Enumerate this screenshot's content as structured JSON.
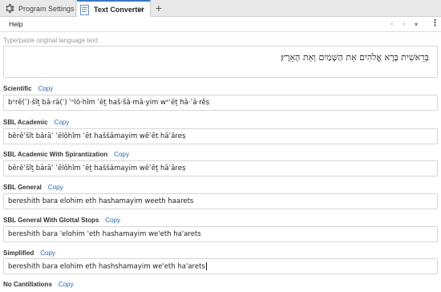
{
  "tabs": [
    {
      "label": "Program Settings",
      "icon": "gear-icon",
      "active": false
    },
    {
      "label": "Text Converter",
      "icon": "document-icon",
      "active": true,
      "close": "✕"
    }
  ],
  "new_tab": "+",
  "toolbar": {
    "help_label": "Help",
    "prev": "‹",
    "next": "›",
    "dropdown": "▾",
    "more": "⋮"
  },
  "input": {
    "label": "Type/paste original language text:",
    "value": "בְּרֵאשִׁית בָּרָא אֱלֹהִים אֵת הַשָּׁמַיִם וְאֵת הָאָרֶץ׃"
  },
  "copy_label": "Copy",
  "sections": [
    {
      "title": "Scientific",
      "value": "bᵊrē(ʾ)·šîṯ bā·rā(ʾ) ʾᵉlō·hîm ʾēṯ haš·šā·mā·yim wᵊʾēṯ hā·ʾā·rěṣ"
    },
    {
      "title": "SBL Academic",
      "value": "bĕrēʾšît bārāʾ ʾĕlōhîm ʾēt haššāmayim wĕʾēt hāʾāreṣ"
    },
    {
      "title": "SBL Academic With Spirantization",
      "value": "bĕrēʾšîṯ bārāʾ ʾĕlōhîm ʾēṯ haššāmayim wĕʾēṯ hāʾāreṣ"
    },
    {
      "title": "SBL General",
      "value": "bereshith bara elohim eth hashamayim weeth haarets"
    },
    {
      "title": "SBL General With Glottal Stops",
      "value": "bereshith bara 'elohim 'eth hashamayim we'eth ha'arets"
    },
    {
      "title": "Simplified",
      "value": "bereshith bara elohim eth hashshamayim we'eth ha'arets"
    },
    {
      "title": "No Cantillations",
      "value": ""
    }
  ]
}
